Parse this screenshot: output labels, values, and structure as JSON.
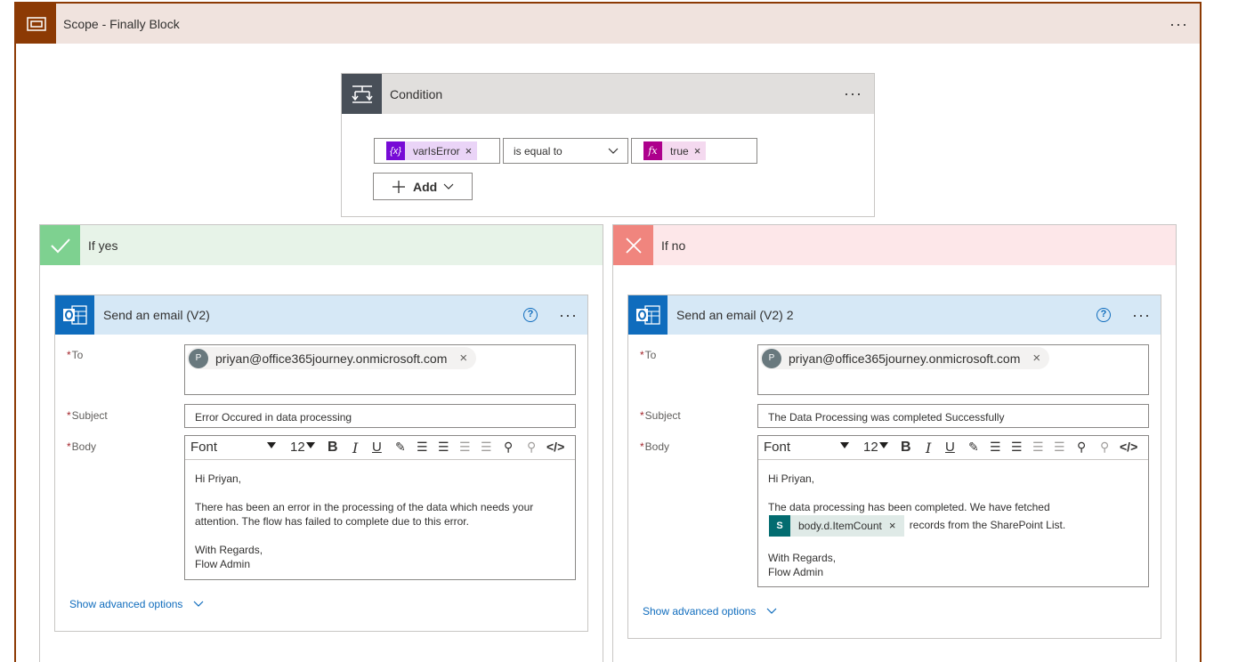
{
  "scope": {
    "title": "Scope - Finally Block",
    "menu": "···"
  },
  "condition": {
    "title": "Condition",
    "menu": "···",
    "left_token": "varIsError",
    "left_icon": "{x}",
    "operator": "is equal to",
    "right_token": "true",
    "right_icon": "fx",
    "remove": "×",
    "add_label": "Add"
  },
  "branches": {
    "yes": {
      "title": "If yes",
      "header_color": "#e7f3e8",
      "icon_color": "#7ed190",
      "card": {
        "title": "Send an email (V2)",
        "help": "?",
        "menu": "···",
        "to_label": "To",
        "to_avatar": "P",
        "to_value": "priyan@office365journey.onmicrosoft.com",
        "subject_label": "Subject",
        "subject_value": "Error Occured in data processing",
        "body_label": "Body",
        "font": "Font",
        "size": "12",
        "body_lines": {
          "l1": "Hi Priyan,",
          "l2": "There has been an error in the processing of the data which needs your",
          "l3": "attention. The flow has failed to complete due to this error.",
          "l4": "With Regards,",
          "l5": "Flow Admin"
        },
        "advanced": "Show advanced options"
      }
    },
    "no": {
      "title": "If no",
      "header_color": "#fde7e9",
      "icon_color": "#f0857e",
      "card": {
        "title": "Send an email (V2) 2",
        "help": "?",
        "menu": "···",
        "to_label": "To",
        "to_avatar": "P",
        "to_value": "priyan@office365journey.onmicrosoft.com",
        "subject_label": "Subject",
        "subject_value": "The Data Processing was completed Successfully",
        "body_label": "Body",
        "font": "Font",
        "size": "12",
        "body_lines": {
          "l1": "Hi Priyan,",
          "l2": "The data processing has been completed. We have fetched",
          "token": "body.d.ItemCount",
          "l3": "records from the SharePoint List.",
          "l4": "With Regards,",
          "l5": "Flow Admin"
        },
        "advanced": "Show advanced options"
      }
    }
  },
  "close_glyph": "×",
  "colors": {
    "scope_accent": "#8c3a04",
    "outlook_blue": "#0f6cbd",
    "variable_purple": "#770bd6",
    "expression_magenta": "#ad008c",
    "sharepoint_teal": "#036c70"
  },
  "icons": [
    "scope-icon",
    "condition-icon",
    "variable-icon",
    "expression-icon",
    "check-icon",
    "close-icon",
    "outlook-icon",
    "help-icon",
    "sharepoint-icon",
    "chevron-down-icon"
  ]
}
